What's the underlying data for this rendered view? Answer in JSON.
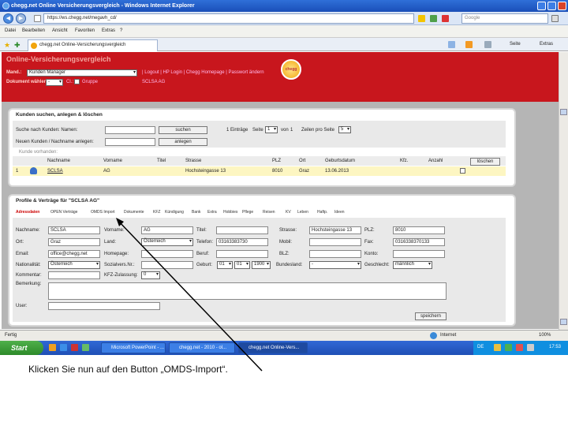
{
  "window": {
    "title": "chegg.net Online Versicherungsvergleich - Windows Internet Explorer"
  },
  "address": {
    "url": "https://ws.chegg.net/megavh_cd/",
    "search_placeholder": "Google"
  },
  "menu": [
    "Datei",
    "Bearbeiten",
    "Ansicht",
    "Favoriten",
    "Extras",
    "?"
  ],
  "tab": {
    "label": "chegg.net Online-Versicherungsvergleich"
  },
  "toolbar": {
    "page": "Seite",
    "extras": "Extras"
  },
  "header": {
    "title": "Online-Versicherungsvergleich",
    "mand_label": "Mand.:",
    "mand_value": "Kunden Manager",
    "links": "| Logout | HP Login | Chegg Homepage | Passwort ändern",
    "makler_label": "Dokument wählen:",
    "makler_value": "-",
    "cl_label": "Cl.:",
    "cl_text": "Gruppe",
    "kunde": "SCLSA AG",
    "logo": "chegg"
  },
  "search_panel": {
    "title": "Kunden suchen, anlegen & löschen",
    "search_label": "Suche nach Kunden: Namen:",
    "search_btn": "suchen",
    "entries": "1 Einträge",
    "page_label": "Seite",
    "page_value": "1",
    "of_label": "von",
    "of_value": "1",
    "rows_label": "Zeilen pro Seite",
    "rows_value": "5",
    "new_label": "Neuen Kunden / Nachname anlegen:",
    "new_btn": "anlegen",
    "hint": "Kunde vorhanden:",
    "headers": [
      "Nachname",
      "Vorname",
      "Titel",
      "Strasse",
      "PLZ",
      "Ort",
      "Geburtsdatum",
      "Kfz.",
      "Anzahl"
    ],
    "row": {
      "nr": "1",
      "nachname": "SCLSA",
      "vorname": "AG",
      "titel": "",
      "strasse": "Hochsteingasse 13",
      "plz": "8010",
      "ort": "Graz",
      "geburt": "13.06.2013",
      "kfz": "",
      "anzahl": ""
    },
    "delete_btn": "löschen"
  },
  "profile_panel": {
    "title": "Profile & Verträge für \"SCLSA AG\"",
    "tabs": [
      "Adressdaten",
      "OPEN Verträge",
      "OMDS Import",
      "Dokumente",
      "KFZ",
      "Kündigung",
      "Bank",
      "Extra",
      "Hobbies",
      "Pflege",
      "Reisen",
      "KV",
      "Leben",
      "Haftp.",
      "Ideen"
    ],
    "fields": {
      "nachname_l": "Nachname:",
      "nachname": "SCLSA",
      "vorname_l": "Vorname:",
      "vorname": "AG",
      "titel_l": "Titel:",
      "titel": "",
      "strasse_l": "Strasse:",
      "strasse": "Hochsteingasse 13",
      "plz_l": "PLZ:",
      "plz": "8010",
      "ort_l": "Ort:",
      "ort": "Graz",
      "land_l": "Land:",
      "land": "Österreich",
      "telefon_l": "Telefon:",
      "telefon": "03163383730",
      "mobil_l": "Mobil:",
      "mobil": "",
      "fax_l": "Fax:",
      "fax": "0316338370133",
      "email_l": "Email:",
      "email": "office@chegg.net",
      "homepage_l": "Homepage:",
      "homepage": "",
      "beruf_l": "Beruf:",
      "beruf": "",
      "blz_l": "BLZ:",
      "blz": "",
      "konto_l": "Konto:",
      "konto": "",
      "nation_l": "Nationalität:",
      "nation": "Österreich",
      "svnr_l": "Sozialvers.Nr.:",
      "svnr": "",
      "geburt_l": "Geburt:",
      "geb_d": "01",
      "geb_m": "01",
      "geb_y": "1900",
      "bundesland_l": "Bundesland:",
      "bundesland": "-",
      "geschlecht_l": "Geschlecht:",
      "geschlecht": "männlich",
      "kommentar_l": "Kommentar:",
      "kfz_l": "KFZ-Zulassung:",
      "kfz": "0",
      "bemerkung_l": "Bemerkung:",
      "user_l": "User:"
    },
    "save_btn": "speichern"
  },
  "status": {
    "text": "Fertig",
    "zone": "Internet",
    "zoom": "100%"
  },
  "taskbar": {
    "start": "Start",
    "items": [
      "Microsoft PowerPoint - ...",
      "chegg.net - 2010 - ol...",
      "chegg.net Online-Vers..."
    ],
    "lang": "DE",
    "time": "17:53"
  },
  "caption": "Klicken Sie nun auf den Button „OMDS-Import“."
}
